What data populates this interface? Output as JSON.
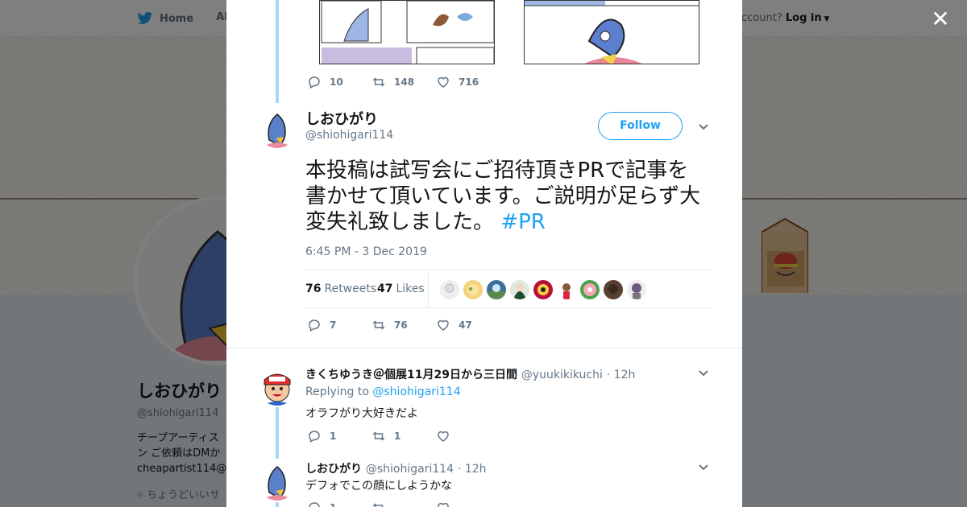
{
  "background": {
    "nav": {
      "home": "Home",
      "about": "Abo"
    },
    "account_prompt": "ccount?",
    "login": "Log in",
    "profile": {
      "name": "しおひがり",
      "handle": "@shiohigari114",
      "bio_line1": "チープアーティス",
      "bio_line2": "ン ご依頼はDMか",
      "bio_line3": "cheapartist114@g",
      "location": "ちょうどいいサ"
    }
  },
  "prev_tweet_actions": {
    "replies": "10",
    "retweets": "148",
    "likes": "716"
  },
  "main_tweet": {
    "name": "しおひがり",
    "handle": "@shiohigari114",
    "follow": "Follow",
    "text": "本投稿は試写会にご招待頂きPRで記事を書かせて頂いています。ご説明が足らず大変失礼致しました。",
    "hashtag": "#PR",
    "time": "6:45 PM - 3 Dec 2019",
    "retweets_count": "76",
    "retweets_label": "Retweets",
    "likes_count": "47",
    "likes_label": "Likes",
    "actions": {
      "replies": "7",
      "retweets": "76",
      "likes": "47"
    }
  },
  "replies": [
    {
      "name": "きくちゆうき＠個展11月29日から三日間",
      "handle": "@yuukikikuchi",
      "time": "· 12h",
      "replying_prefix": "Replying to",
      "replying_to": "@shiohigari114",
      "text": "オラフがり大好きだよ",
      "actions": {
        "replies": "1",
        "retweets": "1",
        "likes": ""
      }
    },
    {
      "name": "しおひがり",
      "handle": "@shiohigari114",
      "time": "· 12h",
      "text": "デフォでこの顔にしようかな",
      "actions": {
        "replies": "1"
      }
    }
  ],
  "colors": {
    "accent": "#1da1f2",
    "thread_line": "#a4d9f9",
    "text": "#14171a",
    "muted": "#657786"
  }
}
